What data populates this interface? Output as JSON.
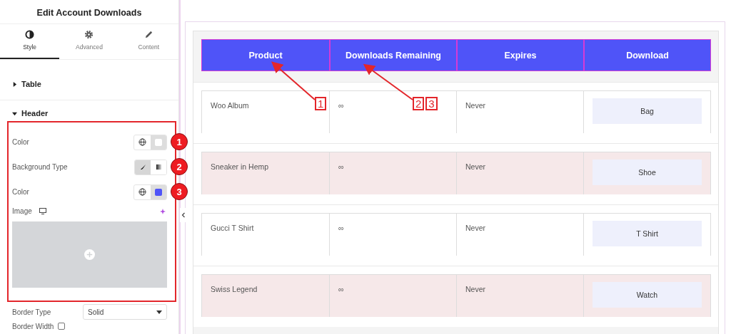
{
  "panel": {
    "title": "Edit Account Downloads",
    "tabs": [
      {
        "label": "Style",
        "selected": true
      },
      {
        "label": "Advanced",
        "selected": false
      },
      {
        "label": "Content",
        "selected": false
      }
    ],
    "sections": [
      {
        "title": "Table",
        "expanded": false
      },
      {
        "title": "Header",
        "expanded": true
      }
    ],
    "controls": [
      {
        "kind": "color",
        "label": "Color",
        "color": "#ffffff",
        "badge": "1"
      },
      {
        "kind": "toggle",
        "label": "Background Type",
        "options": [
          {
            "selected": true
          },
          {
            "selected": false
          }
        ],
        "badge": "2"
      },
      {
        "kind": "color",
        "label": "Color",
        "color": "#4f54f8",
        "badge": "3"
      },
      {
        "kind": "image",
        "label": "Image"
      }
    ],
    "after": [
      {
        "kind": "select",
        "label": "Border Type",
        "value": "Solid"
      },
      {
        "kind": "checkbox",
        "label": "Border Width",
        "checked": false
      }
    ]
  },
  "table": {
    "columns": [
      "Product",
      "Downloads Remaining",
      "Expires",
      "Download"
    ],
    "rows": [
      {
        "product": "Woo Album",
        "remaining": "∞",
        "expires": "Never",
        "button": "Bag",
        "shaded": false
      },
      {
        "product": "Sneaker in Hemp",
        "remaining": "∞",
        "expires": "Never",
        "button": "Shoe",
        "shaded": true
      },
      {
        "product": "Gucci T Shirt",
        "remaining": "∞",
        "expires": "Never",
        "button": "T Shirt",
        "shaded": false
      },
      {
        "product": "Swiss Legend",
        "remaining": "∞",
        "expires": "Never",
        "button": "Watch",
        "shaded": true
      }
    ]
  },
  "callouts": [
    {
      "numbers": [
        "1"
      ]
    },
    {
      "numbers": [
        "2",
        "3"
      ]
    }
  ]
}
